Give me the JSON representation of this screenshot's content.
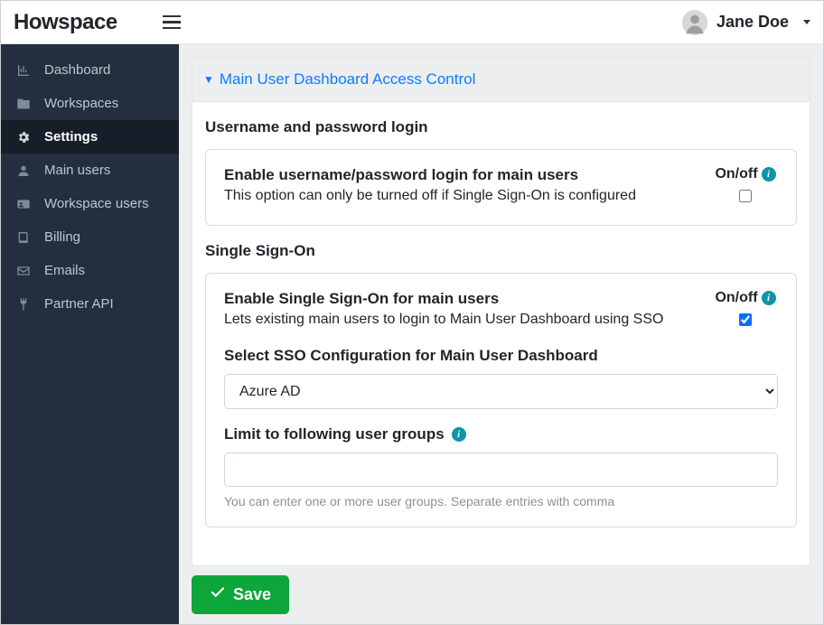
{
  "header": {
    "logo": "Howspace",
    "username": "Jane Doe"
  },
  "sidebar": {
    "items": [
      {
        "label": "Dashboard",
        "icon": "chart"
      },
      {
        "label": "Workspaces",
        "icon": "folder"
      },
      {
        "label": "Settings",
        "icon": "gear",
        "active": true
      },
      {
        "label": "Main users",
        "icon": "user"
      },
      {
        "label": "Workspace users",
        "icon": "id-card"
      },
      {
        "label": "Billing",
        "icon": "book"
      },
      {
        "label": "Emails",
        "icon": "envelope"
      },
      {
        "label": "Partner API",
        "icon": "plug"
      }
    ]
  },
  "panel": {
    "title": "Main User Dashboard Access Control",
    "section1_title": "Username and password login",
    "option1_title": "Enable username/password login for main users",
    "option1_desc": "This option can only be turned off if Single Sign-On is configured",
    "onoff_label": "On/off",
    "option1_checked": false,
    "section2_title": "Single Sign-On",
    "option2_title": "Enable Single Sign-On for main users",
    "option2_desc": "Lets existing main users to login to Main User Dashboard using SSO",
    "option2_checked": true,
    "sso_select_label": "Select SSO Configuration for Main User Dashboard",
    "sso_selected": "Azure AD",
    "groups_label": "Limit to following user groups",
    "groups_value": "",
    "groups_help": "You can enter one or more user groups. Separate entries with comma",
    "save_label": "Save"
  }
}
